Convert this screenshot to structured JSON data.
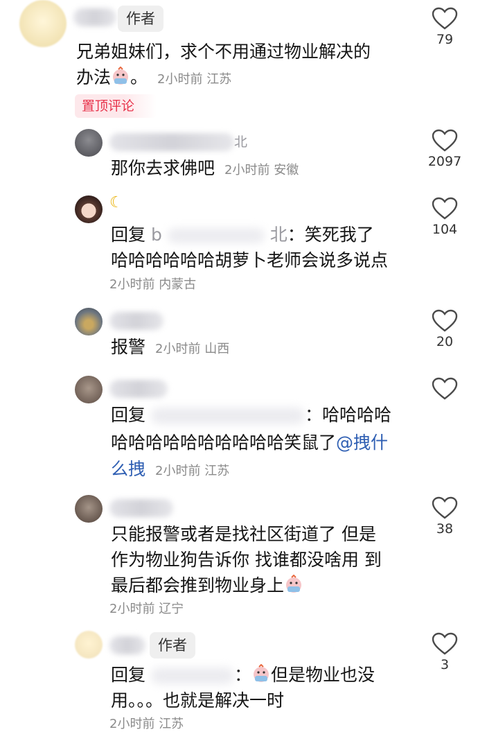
{
  "author_tag": "作者",
  "pinned_label": "置顶评论",
  "comments": [
    {
      "id": "c1",
      "tag": "作者",
      "lines": [
        "兄弟姐妹们，求个不用通过物业解决的",
        "办法"
      ],
      "line2_suffix": "。",
      "time": "2小时前",
      "location": "江苏",
      "likes": "79"
    },
    {
      "id": "c2",
      "name_visible": "北",
      "text": "那你去求佛吧",
      "time": "2小时前",
      "location": "安徽",
      "likes": "2097"
    },
    {
      "id": "c3",
      "reply_prefix": "回复",
      "reply_fragment": "b",
      "reply_fragment2": "北",
      "reply_body": "：笑死我了",
      "line2": "哈哈哈哈哈哈胡萝卜老师会说多说点",
      "time": "2小时前",
      "location": "内蒙古",
      "likes": "104"
    },
    {
      "id": "c4",
      "text": "报警",
      "time": "2小时前",
      "location": "山西",
      "likes": "20"
    },
    {
      "id": "c5",
      "reply_prefix": "回复",
      "reply_body": "：哈哈哈哈",
      "line2": "哈哈哈哈哈哈哈哈哈哈笑鼠了",
      "mention": "@拽什",
      "line3": "么拽",
      "time": "2小时前",
      "location": "江苏",
      "likes": ""
    },
    {
      "id": "c6",
      "lines": [
        "只能报警或者是找社区街道了 但是",
        "作为物业狗告诉你 找谁都没啥用 到",
        "最后都会推到物业身上"
      ],
      "time": "2小时前",
      "location": "辽宁",
      "likes": "38"
    },
    {
      "id": "c7",
      "tag": "作者",
      "reply_prefix": "回复",
      "reply_body": "：",
      "reply_after_emoji": "但是物业也没",
      "line2": "用。。。也就是解决一时",
      "time": "2小时前",
      "location": "江苏",
      "likes": "3"
    }
  ],
  "colors": {
    "accent_red": "#e8334b",
    "mention_blue": "#2f5fb3",
    "meta_gray": "#8a8a8a"
  },
  "icons": [
    "heart-icon",
    "crying-face-emoji"
  ]
}
